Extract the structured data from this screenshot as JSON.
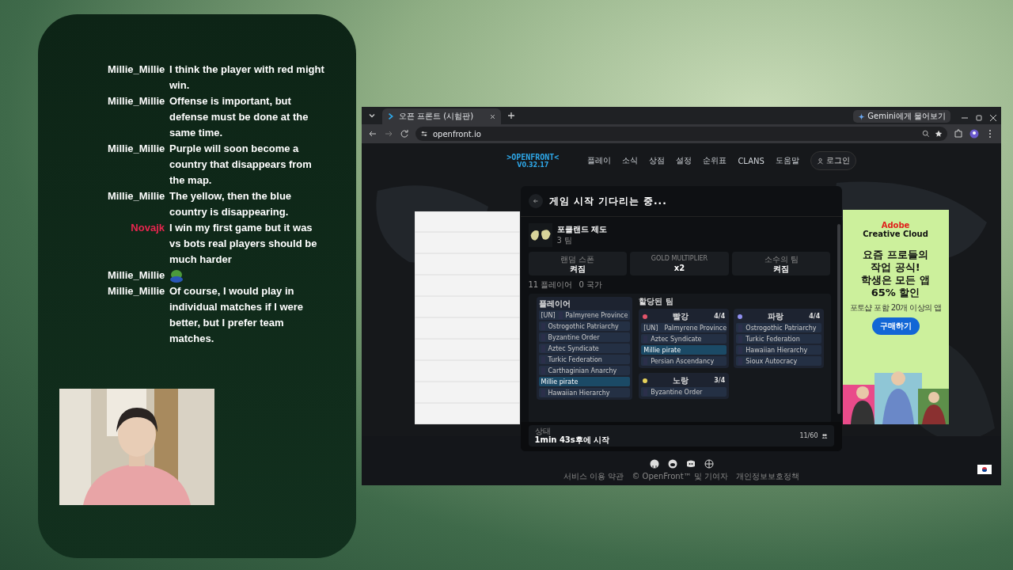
{
  "chat": {
    "messages": [
      {
        "user": "Millie_Millie",
        "color": "#ffffff",
        "kind": "text",
        "text": "I think the player with red might win."
      },
      {
        "user": "Millie_Millie",
        "color": "#ffffff",
        "kind": "text",
        "text": "Offense is important, but defense must be done at the same time."
      },
      {
        "user": "Millie_Millie",
        "color": "#ffffff",
        "kind": "text",
        "text": "Purple will soon become a country that disappears from the map."
      },
      {
        "user": "Millie_Millie",
        "color": "#ffffff",
        "kind": "text",
        "text": "The yellow, then the blue country is disappearing."
      },
      {
        "user": "Novajk",
        "color": "#e8264f",
        "kind": "text",
        "text": "I win my first game but it was vs bots real players should be much harder"
      },
      {
        "user": "Millie_Millie",
        "color": "#ffffff",
        "kind": "emote"
      },
      {
        "user": "Millie_Millie",
        "color": "#ffffff",
        "kind": "text",
        "text": "Of course, I would play in individual matches if I were better, but I prefer team matches."
      }
    ]
  },
  "browser": {
    "tabs": [
      {
        "title": "오픈 프론트 (시험판)",
        "selected": true
      }
    ],
    "gemini_button": "Gemini에게 물어보기",
    "address": "openfront.io",
    "site": {
      "logo": ">OPENFRONT<",
      "version": "V0.32.17",
      "nav": [
        "플레이",
        "소식",
        "상점",
        "설정",
        "순위표",
        "CLANS",
        "도움말"
      ],
      "login": "로그인",
      "modal": {
        "title": "게임 시작 기다리는 중...",
        "map": {
          "name": "포클랜드 제도",
          "subtitle": "3 팀"
        },
        "settings": [
          {
            "label": "랜덤 스폰",
            "value": "켜짐"
          },
          {
            "label": "GOLD MULTIPLIER",
            "value": "x2"
          },
          {
            "label": "소수의 팀",
            "value": "켜짐"
          }
        ],
        "counts": [
          "11 플레이어",
          "0 국가"
        ],
        "players_heading": "플레이어",
        "players": [
          {
            "tag": "[UN]",
            "name": "Palmyrene Province",
            "selected": false
          },
          {
            "name": "Ostrogothic Patriarchy",
            "selected": false
          },
          {
            "name": "Byzantine Order",
            "selected": false
          },
          {
            "name": "Aztec Syndicate",
            "selected": false
          },
          {
            "name": "Turkic Federation",
            "selected": false
          },
          {
            "name": "Carthaginian Anarchy",
            "selected": false
          },
          {
            "name": "Millie pirate",
            "selected": true
          },
          {
            "name": "Hawaiian Hierarchy",
            "selected": false
          }
        ],
        "teams_heading": "할당된 팀",
        "teams": [
          {
            "name": "빨강",
            "color": "#e2546a",
            "count": "4/4",
            "members": [
              {
                "tag": "[UN]",
                "name": "Palmyrene Province",
                "selected": false
              },
              {
                "name": "Aztec Syndicate",
                "selected": false
              },
              {
                "name": "Millie pirate",
                "selected": true
              },
              {
                "name": "Persian Ascendancy",
                "selected": false
              }
            ]
          },
          {
            "name": "파랑",
            "color": "#8f8ff0",
            "count": "4/4",
            "members": [
              {
                "name": "Ostrogothic Patriarchy",
                "selected": false
              },
              {
                "name": "Turkic Federation",
                "selected": false
              },
              {
                "name": "Hawaiian Hierarchy",
                "selected": false
              },
              {
                "name": "Sioux Autocracy",
                "selected": false
              }
            ]
          },
          {
            "name": "노랑",
            "color": "#e6d25a",
            "count": "3/4",
            "members": [
              {
                "name": "Byzantine Order",
                "selected": false
              }
            ]
          }
        ],
        "status": {
          "label": "상태",
          "text": "1min 43s후에 시작",
          "count": "11/60"
        }
      },
      "footer": [
        "서비스 이용 약관",
        "© OpenFront™ 및 기여자",
        "개인정보보호정책"
      ]
    },
    "ad": {
      "brand": "Adobe",
      "product": "Creative Cloud",
      "headline": [
        "요즘 프로들의",
        "작업 공식!",
        "학생은 모든 앱",
        "65% 할인"
      ],
      "subline": "포토샵 포함 20개 이상의 앱",
      "button": "구매하기"
    }
  }
}
